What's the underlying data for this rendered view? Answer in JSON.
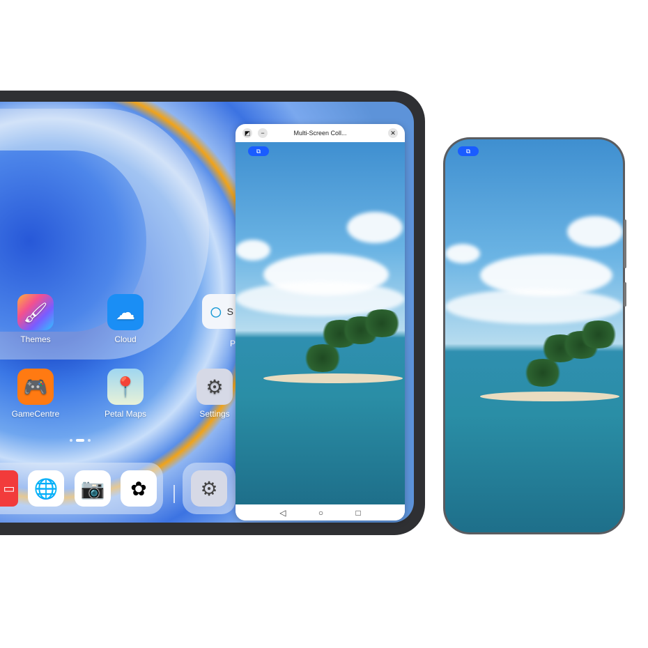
{
  "home": {
    "apps": [
      {
        "label": "Themes",
        "icon": "themes-icon"
      },
      {
        "label": "Cloud",
        "icon": "cloud-icon"
      },
      {
        "label": "GameCentre",
        "icon": "gamepad-icon"
      },
      {
        "label": "Petal Maps",
        "icon": "map-pin-icon"
      },
      {
        "label": "Settings",
        "icon": "settings-gear-icon"
      }
    ],
    "widget_partial": "S",
    "widget_partial2": "P",
    "page_indicator": {
      "pages": 3,
      "current": 2
    },
    "dock": [
      {
        "icon": "notes-icon"
      },
      {
        "icon": "browser-icon"
      },
      {
        "icon": "camera-icon"
      },
      {
        "icon": "gallery-icon"
      },
      {
        "icon": "settings-gear-icon"
      }
    ]
  },
  "window": {
    "title": "Multi-Screen Coll...",
    "controls": [
      "split-icon",
      "minimize-icon",
      "close-icon"
    ],
    "nav": [
      "back-icon",
      "home-icon",
      "recents-icon"
    ]
  },
  "collab_badge": "collaboration-icon",
  "colors": {
    "accent": "#1a5cff",
    "tablet_frame": "#2f3033"
  }
}
